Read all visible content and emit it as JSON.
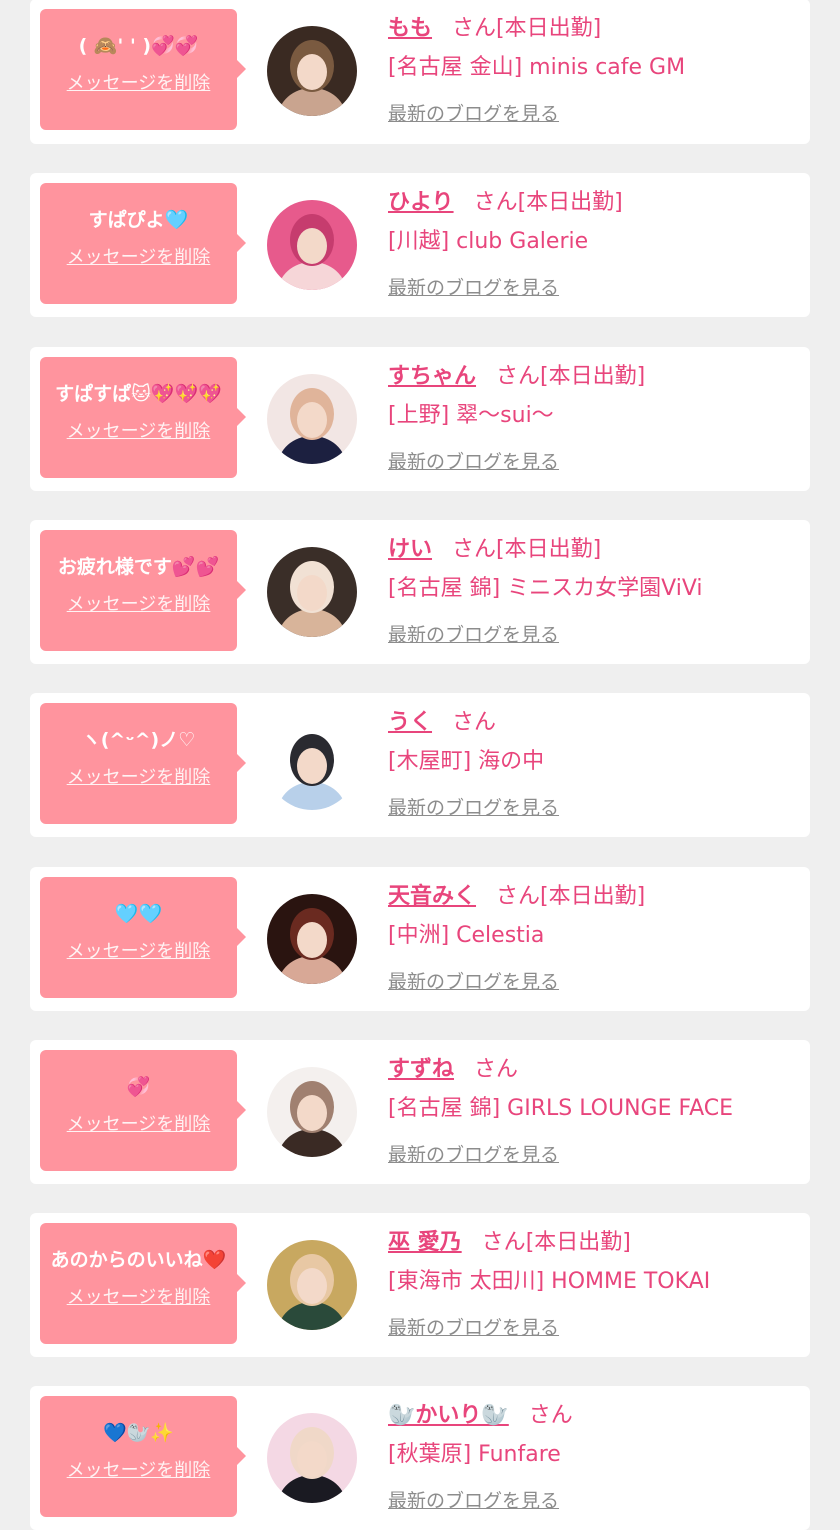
{
  "delete_label": "メッセージを削除",
  "blog_label": "最新のブログを見る",
  "colors": {
    "background": "#efefef",
    "card": "#ffffff",
    "bubble": "#ff949e",
    "accent": "#e8457c",
    "link_gray": "#8c8c8c"
  },
  "messages": [
    {
      "message": "( 🙈' ' )💞💞",
      "name": "もも",
      "san": "さん",
      "status": "[本日出勤]",
      "shop": "[名古屋 金山] minis cafe GM",
      "avatar_icon": "profile-photo",
      "avatar_colors": [
        "#3a2a22",
        "#c9a48f",
        "#7a5a40"
      ]
    },
    {
      "message": "すぱぴよ🩵",
      "name": "ひより",
      "san": "さん",
      "status": "[本日出勤]",
      "shop": "[川越] club Galerie",
      "avatar_icon": "profile-photo",
      "avatar_colors": [
        "#e75a8c",
        "#f6d6d8",
        "#c63c6e"
      ]
    },
    {
      "message": "すぱすぱ🐱💖💖💖",
      "name": "すちゃん",
      "san": "さん",
      "status": "[本日出勤]",
      "shop": "[上野] 翠〜sui〜",
      "avatar_icon": "profile-photo",
      "avatar_colors": [
        "#f2e6e4",
        "#1c2040",
        "#e0b49a"
      ]
    },
    {
      "message": "お疲れ様です💕💕",
      "name": "けい",
      "san": "さん",
      "status": "[本日出勤]",
      "shop": "[名古屋 錦] ミニスカ女学園ViVi",
      "avatar_icon": "profile-photo",
      "avatar_colors": [
        "#3a2e28",
        "#d8b49a",
        "#f1e1d4"
      ]
    },
    {
      "message": "ヽ(^ᵕ^)ノ♡",
      "name": "うく",
      "san": "さん",
      "status": "",
      "shop": "[木屋町] 海の中",
      "avatar_icon": "profile-photo",
      "avatar_colors": [
        "#ffffff",
        "#b8d0ea",
        "#2a2a30"
      ]
    },
    {
      "message": "🩵🩵",
      "name": "天音みく",
      "san": "さん",
      "status": "[本日出勤]",
      "shop": "[中洲] Celestia",
      "avatar_icon": "profile-photo",
      "avatar_colors": [
        "#2a1410",
        "#d8a896",
        "#6a2a20"
      ]
    },
    {
      "message": "💞",
      "name": "すずね",
      "san": "さん",
      "status": "",
      "shop": "[名古屋 錦] GIRLS LOUNGE FACE",
      "avatar_icon": "profile-photo",
      "avatar_colors": [
        "#f4f0ee",
        "#3a2a24",
        "#a08070"
      ]
    },
    {
      "message": "あのからのいいね❤️",
      "name": "巫 愛乃",
      "san": "さん",
      "status": "[本日出勤]",
      "shop": "[東海市 太田川] HOMME TOKAI",
      "avatar_icon": "profile-photo",
      "avatar_colors": [
        "#c8a860",
        "#2a4a3a",
        "#e8c8a4"
      ]
    },
    {
      "message": "💙🦭✨",
      "name": "🦭かいり🦭",
      "san": "さん",
      "status": "",
      "shop": "[秋葉原] Funfare",
      "avatar_icon": "profile-photo",
      "avatar_colors": [
        "#f4d8e4",
        "#1a1a22",
        "#f0d8c8"
      ]
    }
  ]
}
